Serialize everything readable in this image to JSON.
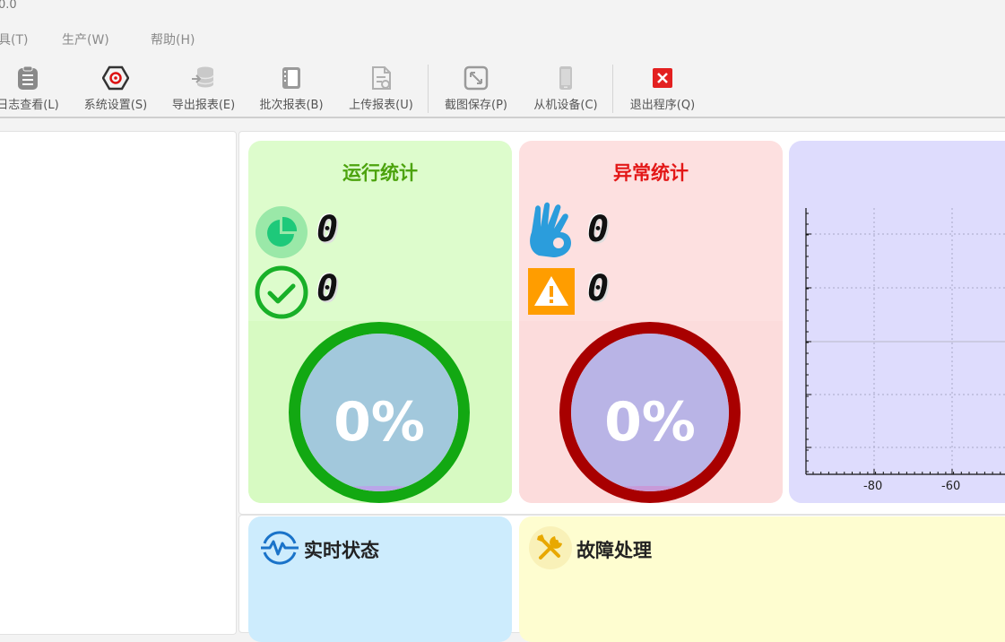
{
  "window": {
    "title_fragment": "0.0"
  },
  "menu": [
    {
      "label": "具(T)"
    },
    {
      "label": "生产(W)"
    },
    {
      "label": "帮助(H)"
    }
  ],
  "toolbar": {
    "log_view": "日志查看(L)",
    "system_settings": "系统设置(S)",
    "export_report": "导出报表(E)",
    "batch_report": "批次报表(B)",
    "upload_report": "上传报表(U)",
    "screenshot_save": "截图保存(P)",
    "slave_device": "从机设备(C)",
    "exit_program": "退出程序(Q)"
  },
  "run_stats": {
    "title": "运行统计",
    "count_total": "0",
    "count_ok": "0",
    "percent": "0%",
    "colors": {
      "bg": "#ddfccc",
      "title": "#4ca30d",
      "ring": "#12a812"
    }
  },
  "abnormal_stats": {
    "title": "异常统计",
    "count_a": "0",
    "count_b": "0",
    "percent": "0%",
    "colors": {
      "bg": "#fde0e0",
      "title": "#e31818",
      "ring": "#a80000"
    }
  },
  "chart_data": {
    "type": "line",
    "x_ticks": [
      "-80",
      "-60"
    ],
    "series": [],
    "grid": true
  },
  "realtime": {
    "title": "实时状态"
  },
  "fault": {
    "title": "故障处理"
  }
}
